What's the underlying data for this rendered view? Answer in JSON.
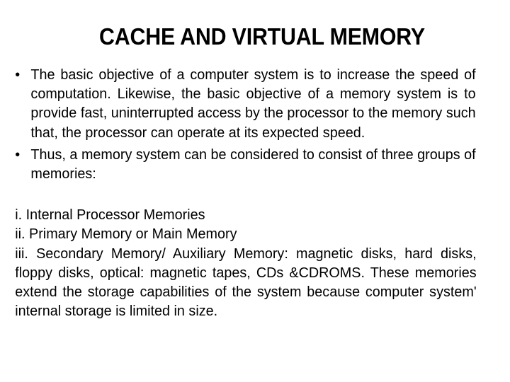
{
  "slide": {
    "title": "CACHE AND VIRTUAL MEMORY",
    "bullets": [
      {
        "marker": "•",
        "text": "The basic objective of a computer system is to increase the speed of computation. Likewise, the basic objective of a memory system is to provide fast, uninterrupted access by the processor to the memory such that, the processor can operate at its expected speed."
      },
      {
        "marker": "•",
        "text": "Thus, a memory system can be considered to consist of three groups of memories:"
      }
    ],
    "list": {
      "item_1": "i. Internal Processor Memories",
      "item_2": "ii. Primary Memory or Main Memory",
      "item_3": "iii. Secondary Memory/ Auxiliary Memory: magnetic disks, hard disks, floppy disks, optical: magnetic tapes, CDs &CDROMS. These memories extend the storage capabilities of the system because computer system' internal storage is limited in size."
    },
    "colors": {
      "text": "#000000",
      "background": "#ffffff"
    }
  }
}
